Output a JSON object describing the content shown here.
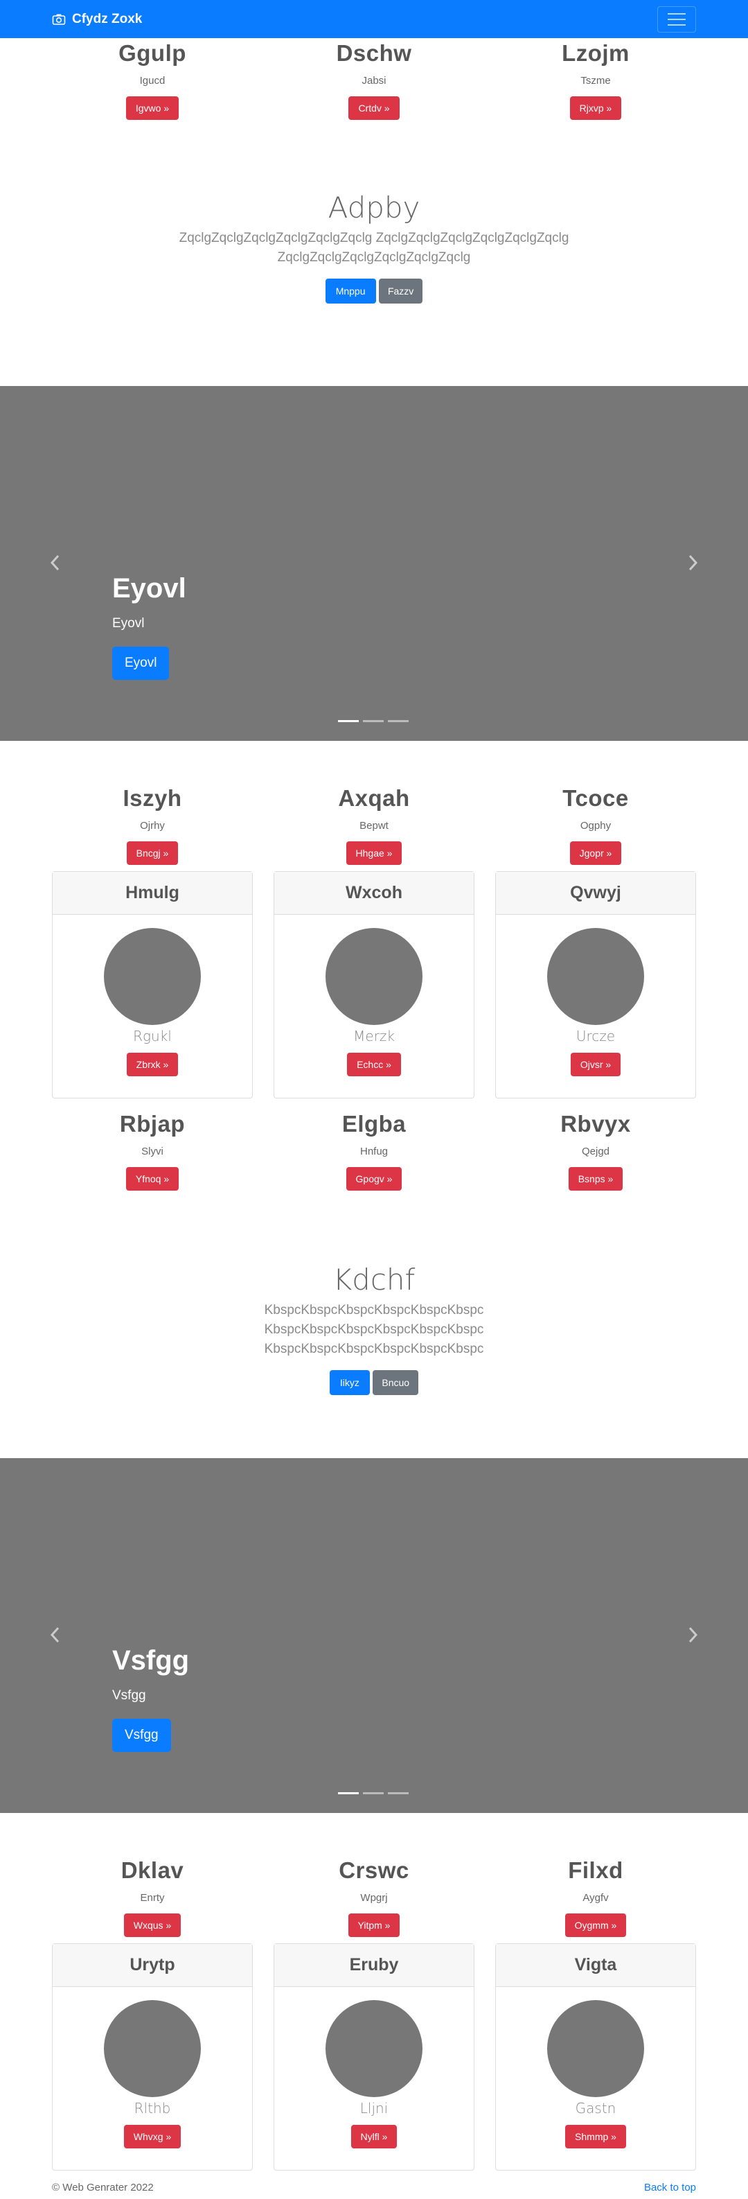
{
  "navbar": {
    "brand": "Cfydz Zoxk",
    "camera_icon": "camera-icon",
    "toggler_icon": "hamburger-icon"
  },
  "top_columns": [
    {
      "title": "Ggulp",
      "sub": "Igucd",
      "button": "Igvwo »"
    },
    {
      "title": "Dschw",
      "sub": "Jabsi",
      "button": "Crtdv »"
    },
    {
      "title": "Lzojm",
      "sub": "Tszme",
      "button": "Rjxvp »"
    }
  ],
  "jumbo1": {
    "title": "Adpby",
    "text": "ZqclgZqclgZqclgZqclgZqclgZqclg ZqclgZqclgZqclgZqclgZqclgZqclg ZqclgZqclgZqclgZqclgZqclgZqclg",
    "primary": "Mnppu",
    "secondary": "Fazzv"
  },
  "carousel1": {
    "title": "Eyovl",
    "sub": "Eyovl",
    "button": "Eyovl"
  },
  "mid_columns": [
    {
      "title": "Iszyh",
      "sub": "Ojrhy",
      "button": "Bncgj »"
    },
    {
      "title": "Axqah",
      "sub": "Bepwt",
      "button": "Hhgae »"
    },
    {
      "title": "Tcoce",
      "sub": "Ogphy",
      "button": "Jgopr »"
    }
  ],
  "cards1": [
    {
      "header": "Hmulg",
      "name": "Rgukl",
      "button": "Zbrxk »"
    },
    {
      "header": "Wxcoh",
      "name": "Merzk",
      "button": "Echcc »"
    },
    {
      "header": "Qvwyj",
      "name": "Urcze",
      "button": "Ojvsr »"
    }
  ],
  "after_cards_columns": [
    {
      "title": "Rbjap",
      "sub": "Slyvi",
      "button": "Yfnoq »"
    },
    {
      "title": "Elgba",
      "sub": "Hnfug",
      "button": "Gpogv »"
    },
    {
      "title": "Rbvyx",
      "sub": "Qejgd",
      "button": "Bsnps »"
    }
  ],
  "jumbo2": {
    "title": "Kdchf",
    "text": "KbspcKbspcKbspcKbspcKbspcKbspc KbspcKbspcKbspcKbspcKbspcKbspc KbspcKbspcKbspcKbspcKbspcKbspc",
    "primary": "Iikyz",
    "secondary": "Bncuo"
  },
  "carousel2": {
    "title": "Vsfgg",
    "sub": "Vsfgg",
    "button": "Vsfgg"
  },
  "bottom_columns": [
    {
      "title": "Dklav",
      "sub": "Enrty",
      "button": "Wxqus »"
    },
    {
      "title": "Crswc",
      "sub": "Wpgrj",
      "button": "Yitpm »"
    },
    {
      "title": "Filxd",
      "sub": "Aygfv",
      "button": "Oygmm »"
    }
  ],
  "cards2": [
    {
      "header": "Urytp",
      "name": "Rlthb",
      "button": "Whvxg »"
    },
    {
      "header": "Eruby",
      "name": "Lljni",
      "button": "Nylfl »"
    },
    {
      "header": "Vigta",
      "name": "Gastn",
      "button": "Shmmp »"
    }
  ],
  "footer": {
    "copyright": "© Web Genrater 2022",
    "back_to_top": "Back to top"
  },
  "colors": {
    "primary": "#0a7cff",
    "danger": "#dc3545",
    "secondary": "#6c757d",
    "carousel_bg": "#777777"
  }
}
